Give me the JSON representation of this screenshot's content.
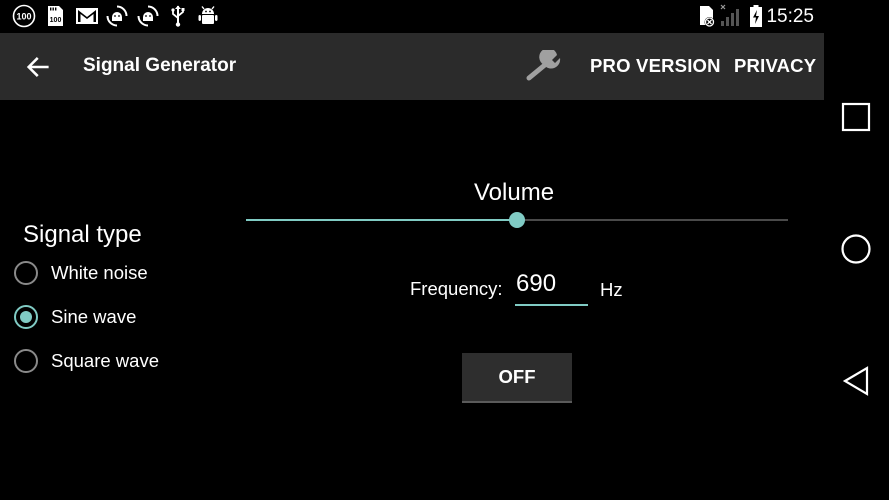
{
  "status_bar": {
    "time": "15:25",
    "left_icons": [
      "badge-100-icon",
      "sd-card-100-icon",
      "gmail-icon",
      "android-sync-icon",
      "android-sync-icon-2",
      "usb-icon",
      "android-debug-icon"
    ],
    "right_icons": [
      "sim-card-missing-icon",
      "signal-strength-icon",
      "battery-charging-icon"
    ],
    "badge_text": "100"
  },
  "app_bar": {
    "title": "Signal Generator",
    "pro_version": "PRO VERSION",
    "privacy": "PRIVACY",
    "icons": [
      "back-arrow-icon",
      "wrench-icon"
    ]
  },
  "signal": {
    "label": "Signal type",
    "options": [
      "White noise",
      "Sine wave",
      "Square wave"
    ],
    "selected": "Sine wave"
  },
  "volume": {
    "label": "Volume",
    "level": 0.5
  },
  "frequency": {
    "label": "Frequency:",
    "value": "690",
    "unit": "Hz"
  },
  "toggle": {
    "label": "OFF"
  },
  "nav_bar": {
    "icons": [
      "recent-apps-icon",
      "home-icon",
      "back-icon"
    ]
  },
  "colors": {
    "accent": "#80cbc4",
    "app_bar": "#2b2b2b",
    "background": "#000000"
  }
}
